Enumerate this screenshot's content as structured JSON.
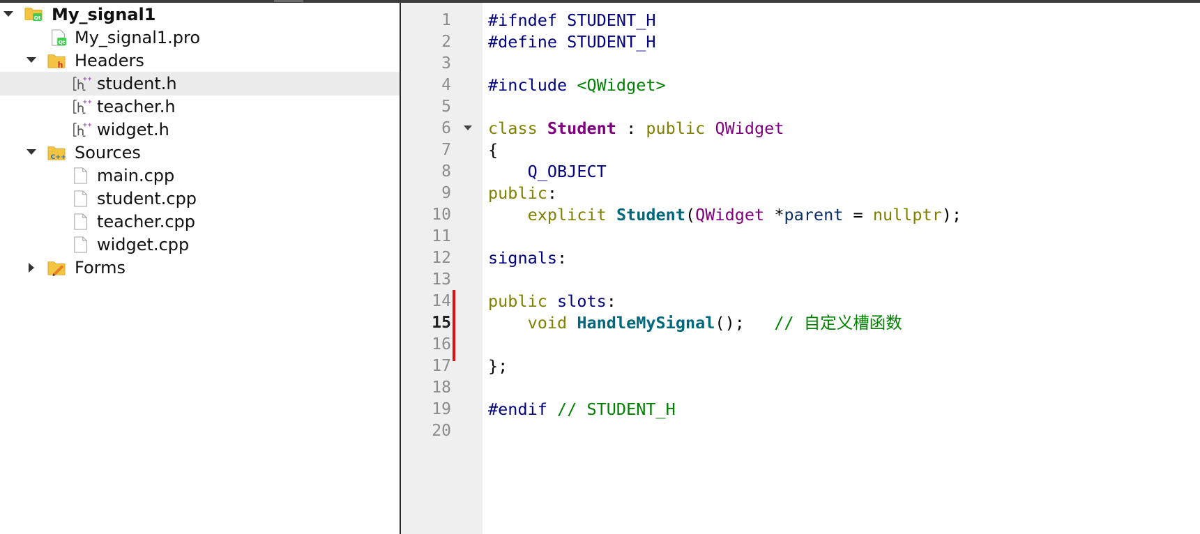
{
  "project_tree": {
    "root": {
      "label": "My_signal1",
      "icon": "qt-project-folder-icon",
      "expanded": true
    },
    "pro_file": {
      "label": "My_signal1.pro",
      "icon": "qt-pro-file-icon"
    },
    "headers": {
      "label": "Headers",
      "icon": "headers-folder-icon",
      "expanded": true,
      "files": [
        {
          "label": "student.h",
          "icon": "header-file-icon",
          "selected": true
        },
        {
          "label": "teacher.h",
          "icon": "header-file-icon"
        },
        {
          "label": "widget.h",
          "icon": "header-file-icon"
        }
      ]
    },
    "sources": {
      "label": "Sources",
      "icon": "sources-folder-icon",
      "expanded": true,
      "files": [
        {
          "label": "main.cpp",
          "icon": "file-icon"
        },
        {
          "label": "student.cpp",
          "icon": "file-icon"
        },
        {
          "label": "teacher.cpp",
          "icon": "file-icon"
        },
        {
          "label": "widget.cpp",
          "icon": "file-icon"
        }
      ]
    },
    "forms": {
      "label": "Forms",
      "icon": "forms-folder-icon",
      "expanded": false
    }
  },
  "editor": {
    "current_line": 15,
    "changed_lines": [
      13,
      14,
      15
    ],
    "folding_marker_line": 6,
    "lines": [
      {
        "n": "1",
        "tokens": [
          {
            "t": "#ifndef STUDENT_H",
            "c": "pp"
          }
        ]
      },
      {
        "n": "2",
        "tokens": [
          {
            "t": "#define STUDENT_H",
            "c": "pp"
          }
        ]
      },
      {
        "n": "3",
        "tokens": []
      },
      {
        "n": "4",
        "tokens": [
          {
            "t": "#include ",
            "c": "pp"
          },
          {
            "t": "<QWidget>",
            "c": "str"
          }
        ]
      },
      {
        "n": "5",
        "tokens": []
      },
      {
        "n": "6",
        "tokens": [
          {
            "t": "class ",
            "c": "kw"
          },
          {
            "t": "Student",
            "c": "cls"
          },
          {
            "t": " : ",
            "c": "plain"
          },
          {
            "t": "public ",
            "c": "kw"
          },
          {
            "t": "QWidget",
            "c": "type"
          }
        ]
      },
      {
        "n": "7",
        "tokens": [
          {
            "t": "{",
            "c": "plain"
          }
        ]
      },
      {
        "n": "8",
        "tokens": [
          {
            "t": "    ",
            "c": "plain"
          },
          {
            "t": "Q_OBJECT",
            "c": "mac"
          }
        ]
      },
      {
        "n": "9",
        "tokens": [
          {
            "t": "public",
            "c": "kw"
          },
          {
            "t": ":",
            "c": "plain"
          }
        ]
      },
      {
        "n": "10",
        "tokens": [
          {
            "t": "    ",
            "c": "plain"
          },
          {
            "t": "explicit ",
            "c": "kw"
          },
          {
            "t": "Student",
            "c": "fn"
          },
          {
            "t": "(",
            "c": "plain"
          },
          {
            "t": "QWidget",
            "c": "type"
          },
          {
            "t": " *",
            "c": "plain"
          },
          {
            "t": "parent",
            "c": "var"
          },
          {
            "t": " = ",
            "c": "plain"
          },
          {
            "t": "nullptr",
            "c": "kw"
          },
          {
            "t": ");",
            "c": "plain"
          }
        ]
      },
      {
        "n": "11",
        "tokens": []
      },
      {
        "n": "12",
        "tokens": [
          {
            "t": "signals",
            "c": "sig"
          },
          {
            "t": ":",
            "c": "plain"
          }
        ]
      },
      {
        "n": "13",
        "tokens": []
      },
      {
        "n": "14",
        "tokens": [
          {
            "t": "public ",
            "c": "kw"
          },
          {
            "t": "slots",
            "c": "sig"
          },
          {
            "t": ":",
            "c": "plain"
          }
        ]
      },
      {
        "n": "15",
        "tokens": [
          {
            "t": "    ",
            "c": "plain"
          },
          {
            "t": "void ",
            "c": "kw"
          },
          {
            "t": "HandleMySignal",
            "c": "fn"
          },
          {
            "t": "();   ",
            "c": "plain"
          },
          {
            "t": "// 自定义槽函数",
            "c": "com"
          }
        ]
      },
      {
        "n": "16",
        "tokens": []
      },
      {
        "n": "17",
        "tokens": [
          {
            "t": "};",
            "c": "plain"
          }
        ]
      },
      {
        "n": "18",
        "tokens": []
      },
      {
        "n": "19",
        "tokens": [
          {
            "t": "#endif ",
            "c": "pp"
          },
          {
            "t": "// STUDENT_H",
            "c": "com"
          }
        ]
      },
      {
        "n": "20",
        "tokens": []
      }
    ]
  },
  "colors": {
    "preprocessor": "#000080",
    "string": "#008000",
    "keyword": "#808000",
    "type": "#800080",
    "function": "#00677c",
    "comment": "#008000",
    "change_bar": "#e01010",
    "selection": "#ececec",
    "gutter": "#efefef"
  }
}
